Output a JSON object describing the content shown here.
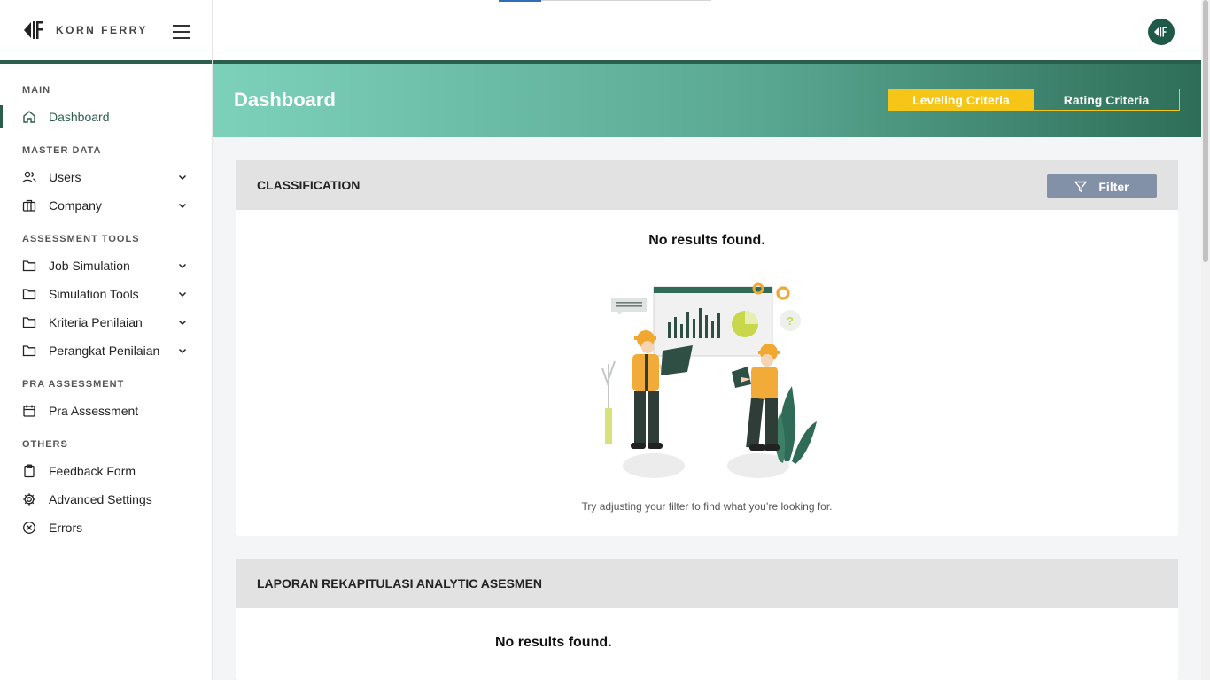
{
  "brand": {
    "name": "KORN FERRY"
  },
  "nav": {
    "sections": [
      {
        "title": "MAIN",
        "items": [
          {
            "label": "Dashboard",
            "icon": "home-icon",
            "active": true
          }
        ]
      },
      {
        "title": "MASTER DATA",
        "items": [
          {
            "label": "Users",
            "icon": "users-icon"
          },
          {
            "label": "Company",
            "icon": "briefcase-icon"
          }
        ]
      },
      {
        "title": "ASSESSMENT TOOLS",
        "items": [
          {
            "label": "Job Simulation",
            "icon": "folder-icon"
          },
          {
            "label": "Simulation Tools",
            "icon": "folder-icon"
          },
          {
            "label": "Kriteria Penilaian",
            "icon": "folder-icon"
          },
          {
            "label": "Perangkat Penilaian",
            "icon": "folder-icon"
          }
        ]
      },
      {
        "title": "PRA ASSESSMENT",
        "items": [
          {
            "label": "Pra Assessment",
            "icon": "calendar-icon"
          }
        ]
      },
      {
        "title": "OTHERS",
        "items": [
          {
            "label": "Feedback Form",
            "icon": "clipboard-icon"
          },
          {
            "label": "Advanced Settings",
            "icon": "gear-icon"
          },
          {
            "label": "Errors",
            "icon": "x-circle-icon"
          }
        ]
      }
    ]
  },
  "header": {
    "title": "Dashboard",
    "tabs": [
      {
        "label": "Leveling Criteria",
        "active": true
      },
      {
        "label": "Rating Criteria",
        "active": false
      }
    ]
  },
  "classification": {
    "title": "CLASSIFICATION",
    "filter_label": "Filter",
    "empty_title": "No results found.",
    "empty_hint": "Try adjusting your filter to find what you’re looking for."
  },
  "report": {
    "title": "LAPORAN REKAPITULASI ANALYTIC ASESMEN",
    "empty_title": "No results found."
  },
  "colors": {
    "brand_green": "#2b5e4c",
    "accent_yellow": "#f5c518",
    "filter_button": "#8391a8"
  }
}
